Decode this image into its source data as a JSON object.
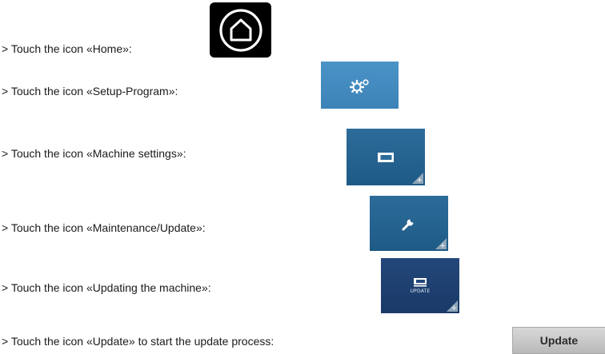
{
  "steps": [
    {
      "text": "> Touch the icon «Home»:"
    },
    {
      "text": "> Touch the icon «Setup-Program»:"
    },
    {
      "text": "> Touch the icon «Machine settings»:"
    },
    {
      "text": "> Touch the icon «Maintenance/Update»:"
    },
    {
      "text": "> Touch the icon «Updating the machine»:"
    },
    {
      "text": "> Touch the icon «Update» to start the update process:"
    }
  ],
  "icons": {
    "home": "home-icon",
    "setup_program": "gears-icon",
    "machine_settings": "machine-icon",
    "maintenance_update": "wrench-icon",
    "updating_machine": "machine-update-icon",
    "corner_marker": "+"
  },
  "updating_tile": {
    "caption": "UPDATE"
  },
  "update_button": {
    "label": "Update"
  },
  "colors": {
    "setup_tile": "#4a93c7",
    "blue_tile": "#2c6c9a",
    "update_tile": "#23477a",
    "home_bg": "#000000",
    "button_bg": "#c8c8c8"
  }
}
